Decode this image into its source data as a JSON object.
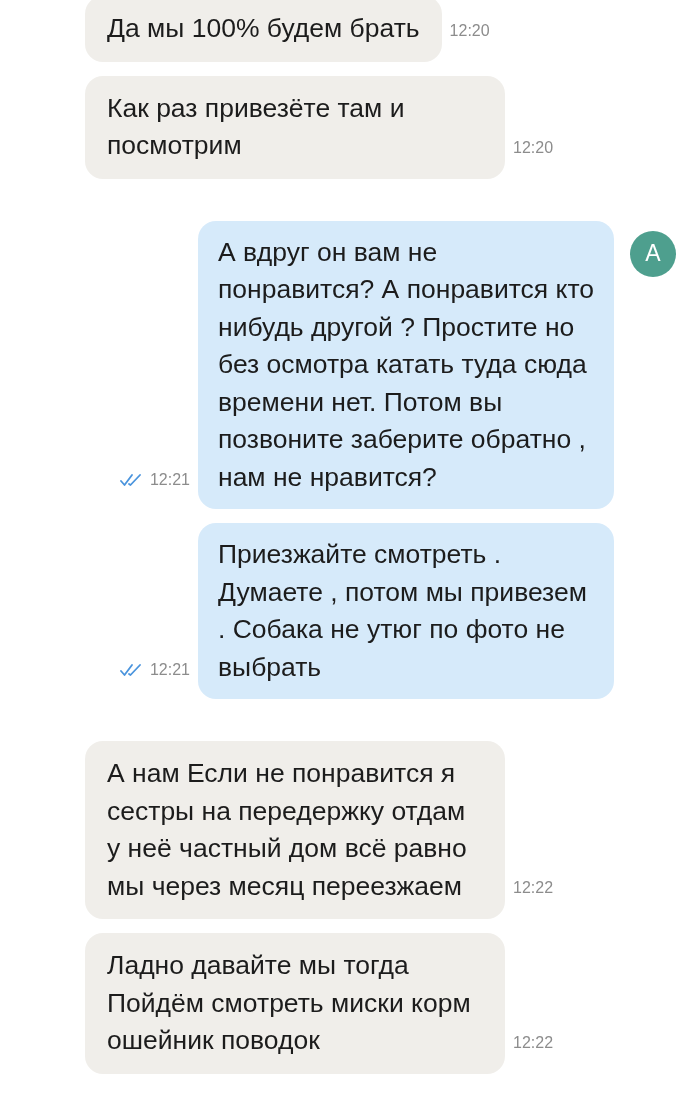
{
  "messages": [
    {
      "kind": "incoming",
      "text": "Да мы 100% будем брать",
      "time": "12:20"
    },
    {
      "kind": "incoming",
      "text": "Как раз привезёте там и посмотрим",
      "time": "12:20"
    },
    {
      "kind": "outgoing",
      "text": "А вдруг он вам не понравится? А понравится кто нибудь другой ? Простите но без осмотра катать туда сюда времени нет. Потом вы позвоните заберите обратно , нам не нравится?",
      "time": "12:21",
      "read": true,
      "avatar": {
        "letter": "A"
      }
    },
    {
      "kind": "outgoing",
      "text": "Приезжайте смотреть . Думаете , потом мы привезем . Собака не утюг по фото не выбрать",
      "time": "12:21",
      "read": true
    },
    {
      "kind": "incoming",
      "text": "А нам Если не понравится я сестры на передержку отдам у неё частный дом всё равно мы через месяц переезжаем",
      "time": "12:22"
    },
    {
      "kind": "incoming",
      "text": "Ладно давайте мы тогда Пойдём смотреть миски корм ошейник поводок",
      "time": "12:22"
    }
  ]
}
